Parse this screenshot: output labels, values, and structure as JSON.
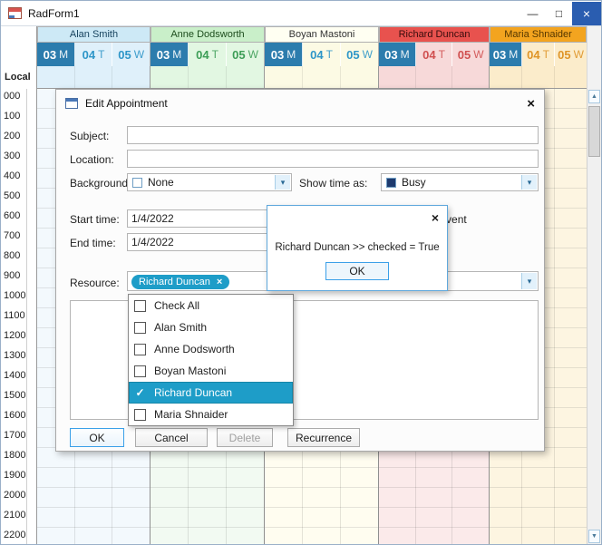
{
  "window": {
    "title": "RadForm1"
  },
  "icons": {
    "minimize": "—",
    "maximize": "□",
    "close": "×",
    "chevron_down": "▾",
    "check": "✓",
    "remove": "×",
    "scroll_up": "▲",
    "scroll_down": "▼"
  },
  "scheduler": {
    "local_label": "Local",
    "times": [
      "000",
      "100",
      "200",
      "300",
      "400",
      "500",
      "600",
      "700",
      "800",
      "900",
      "1000",
      "1100",
      "1200",
      "1300",
      "1400",
      "1500",
      "1600",
      "1700",
      "1800",
      "1900",
      "2000",
      "2100",
      "2200"
    ],
    "selected_day": {
      "bg": "#2c7cad",
      "text": "#ffffff"
    },
    "resources": [
      {
        "name": "Alan Smith",
        "header_bg": "#cde9f6",
        "header_text": "#17435f",
        "day_bg": "#dff0fa",
        "day_text": "#2e96c8",
        "col_bg": "#f3f9fd",
        "days": [
          {
            "num": "03",
            "dow": "M",
            "selected": true
          },
          {
            "num": "04",
            "dow": "T",
            "selected": false
          },
          {
            "num": "05",
            "dow": "W",
            "selected": false
          }
        ]
      },
      {
        "name": "Anne Dodsworth",
        "header_bg": "#c9efc9",
        "header_text": "#1d4d1d",
        "day_bg": "#e2f7e2",
        "day_text": "#3d9e57",
        "col_bg": "#f2faf2",
        "days": [
          {
            "num": "03",
            "dow": "M",
            "selected": true
          },
          {
            "num": "04",
            "dow": "T",
            "selected": false
          },
          {
            "num": "05",
            "dow": "W",
            "selected": false
          }
        ]
      },
      {
        "name": "Boyan Mastoni",
        "header_bg": "#fffff2",
        "header_text": "#333333",
        "day_bg": "#fcfae4",
        "day_text": "#2e96c8",
        "col_bg": "#fffdf0",
        "days": [
          {
            "num": "03",
            "dow": "M",
            "selected": true
          },
          {
            "num": "04",
            "dow": "T",
            "selected": false
          },
          {
            "num": "05",
            "dow": "W",
            "selected": false
          }
        ]
      },
      {
        "name": "Richard Duncan",
        "header_bg": "#e8524e",
        "header_text": "#380c0c",
        "day_bg": "#f7d9d9",
        "day_text": "#d05050",
        "col_bg": "#fbeaea",
        "days": [
          {
            "num": "03",
            "dow": "M",
            "selected": true
          },
          {
            "num": "04",
            "dow": "T",
            "selected": false
          },
          {
            "num": "05",
            "dow": "W",
            "selected": false
          }
        ]
      },
      {
        "name": "Maria Shnaider",
        "header_bg": "#f3a41f",
        "header_text": "#553700",
        "day_bg": "#fbeccb",
        "day_text": "#df9426",
        "col_bg": "#fdf5e1",
        "days": [
          {
            "num": "03",
            "dow": "M",
            "selected": true
          },
          {
            "num": "04",
            "dow": "T",
            "selected": false
          },
          {
            "num": "05",
            "dow": "W",
            "selected": false
          }
        ]
      }
    ]
  },
  "dialog": {
    "title": "Edit Appointment",
    "subject_label": "Subject:",
    "location_label": "Location:",
    "background_label": "Background:",
    "background_value": "None",
    "none_swatch": "#ffffff",
    "show_time_label": "Show time as:",
    "show_time_value": "Busy",
    "busy_swatch": "#1e3a6e",
    "start_label": "Start time:",
    "start_value": "1/4/2022",
    "all_day_label": "All day event",
    "end_label": "End time:",
    "end_value": "1/4/2022",
    "resource_label": "Resource:",
    "resource_token": "Richard Duncan",
    "accent": "#1e9dc8",
    "buttons": {
      "ok": "OK",
      "cancel": "Cancel",
      "delete": "Delete",
      "recurrence": "Recurrence"
    },
    "resource_list": [
      {
        "label": "Check All",
        "checked": false
      },
      {
        "label": "Alan Smith",
        "checked": false
      },
      {
        "label": "Anne Dodsworth",
        "checked": false
      },
      {
        "label": "Boyan Mastoni",
        "checked": false
      },
      {
        "label": "Richard Duncan",
        "checked": true
      },
      {
        "label": "Maria Shnaider",
        "checked": false
      }
    ]
  },
  "popup": {
    "message": "Richard Duncan >> checked = True",
    "ok_label": "OK"
  }
}
